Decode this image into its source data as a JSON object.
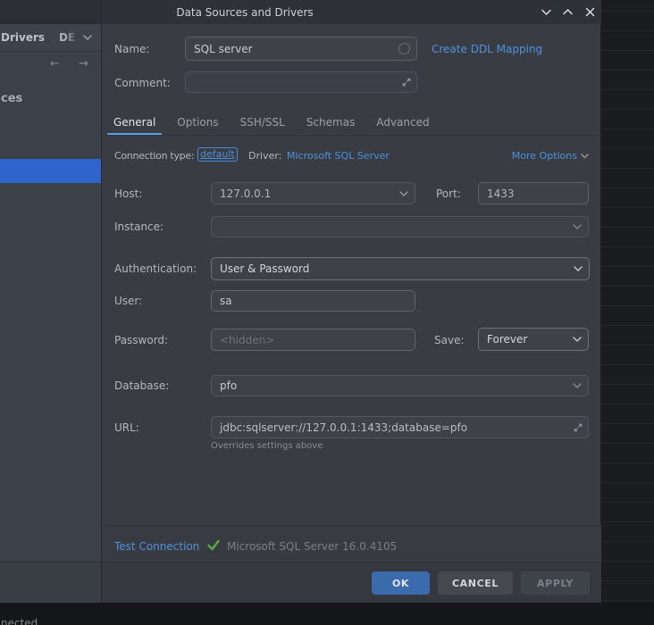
{
  "window": {
    "title": "Data Sources and Drivers",
    "controls": [
      "minimize",
      "maximize",
      "close"
    ]
  },
  "ide_background": {
    "toolbar_project": "Drivers",
    "toolbar_combo_partial": "DE",
    "back_arrow": "←",
    "forward_arrow": "→",
    "tree_item_partial": "ces",
    "status_partial": "nected"
  },
  "header": {
    "name_label": "Name:",
    "name_value": "SQL server",
    "ddl_link": "Create DDL Mapping",
    "comment_label": "Comment:",
    "comment_value": ""
  },
  "tabs": [
    {
      "label": "General",
      "active": true
    },
    {
      "label": "Options",
      "active": false
    },
    {
      "label": "SSH/SSL",
      "active": false
    },
    {
      "label": "Schemas",
      "active": false
    },
    {
      "label": "Advanced",
      "active": false
    }
  ],
  "general": {
    "connection_type_label": "Connection type:",
    "connection_type_value": "default",
    "driver_label": "Driver:",
    "driver_link": "Microsoft SQL Server",
    "more_options_label": "More Options",
    "host_label": "Host:",
    "host_value": "127.0.0.1",
    "port_label": "Port:",
    "port_value": "1433",
    "instance_label": "Instance:",
    "instance_value": "",
    "auth_label": "Authentication:",
    "auth_value": "User & Password",
    "user_label": "User:",
    "user_value": "sa",
    "password_label": "Password:",
    "password_placeholder": "<hidden>",
    "save_label": "Save:",
    "save_value": "Forever",
    "database_label": "Database:",
    "database_value": "pfo",
    "url_label": "URL:",
    "url_value": "jdbc:sqlserver://127.0.0.1:1433;database=pfo",
    "url_note": "Overrides settings above"
  },
  "footer": {
    "test_link": "Test Connection",
    "result_text": "Microsoft SQL Server 16.0.4105"
  },
  "actions": {
    "ok": "OK",
    "cancel": "CANCEL",
    "apply": "APPLY"
  },
  "colors": {
    "accent_blue": "#4f90dc",
    "selection_blue": "#2e64cb",
    "success_green": "#57a83f",
    "primary_button": "#3c6bad",
    "tab_underline": "#55a1e8"
  }
}
